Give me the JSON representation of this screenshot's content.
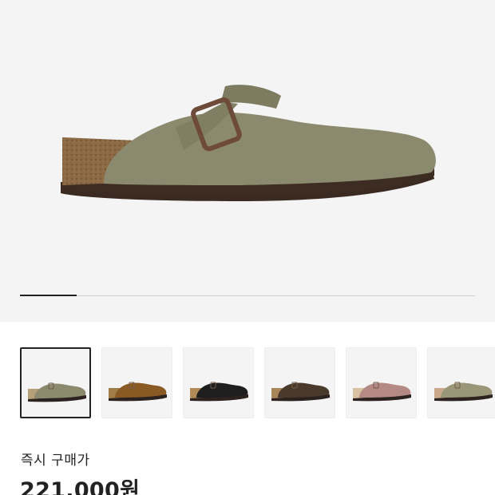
{
  "gallery": {
    "progress": 0.125,
    "main_image": "boston-clog-taupe-suede",
    "thumbnails": [
      {
        "name": "thumbnail-taupe",
        "upper": "#8b8a6e",
        "sole": "#b5a07a",
        "selected": true
      },
      {
        "name": "thumbnail-mink",
        "upper": "#8a5a24",
        "sole": "#a07c48",
        "selected": false
      },
      {
        "name": "thumbnail-black",
        "upper": "#1e1e1e",
        "sole": "#b08a58",
        "selected": false
      },
      {
        "name": "thumbnail-mocha",
        "upper": "#4a3a2c",
        "sole": "#a8865a",
        "selected": false
      },
      {
        "name": "thumbnail-pink",
        "upper": "#b58a84",
        "sole": "#d8c2a4",
        "selected": false
      },
      {
        "name": "thumbnail-stone",
        "upper": "#9a9678",
        "sole": "#caa98a",
        "selected": false
      }
    ]
  },
  "pricing": {
    "label": "즉시 구매가",
    "value": "221,000원"
  }
}
